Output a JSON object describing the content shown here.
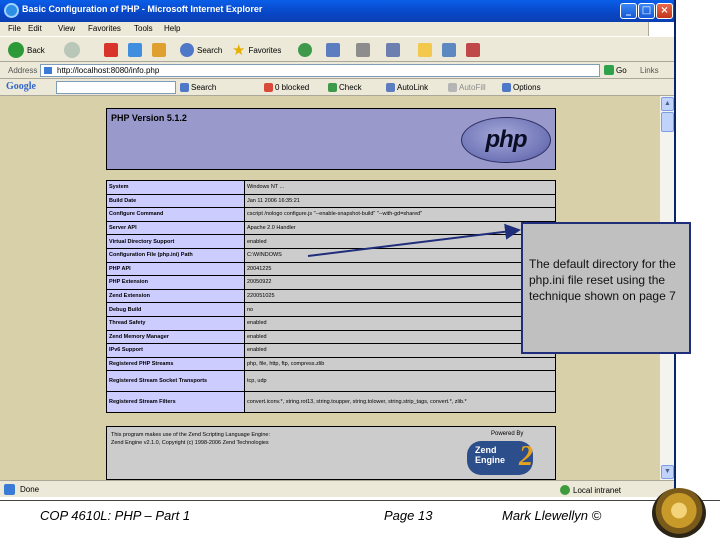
{
  "window": {
    "title": "Basic Configuration of PHP - Microsoft Internet Explorer",
    "min": "_",
    "max": "□",
    "close": "×"
  },
  "menu": [
    "File",
    "Edit",
    "View",
    "Favorites",
    "Tools",
    "Help"
  ],
  "toolbar": {
    "back": "Back",
    "search": "Search",
    "favorites": "Favorites"
  },
  "address": {
    "label": "Address",
    "url": "http://localhost:8080/info.php",
    "go": "Go",
    "links": "Links"
  },
  "google": {
    "logo": "Google",
    "search": "Search",
    "blocked": "0 blocked",
    "check": "Check",
    "autolink": "AutoLink",
    "autofill": "AutoFill",
    "options": "Options"
  },
  "php": {
    "version": "PHP Version 5.1.2",
    "logo": "php",
    "rows": [
      {
        "k": "System",
        "v": "Windows NT ...",
        "tall": false
      },
      {
        "k": "Build Date",
        "v": "Jan 11 2006 16:35:21",
        "tall": false
      },
      {
        "k": "Configure Command",
        "v": "cscript /nologo configure.js \"--enable-snapshot-build\" \"--with-gd=shared\"",
        "tall": false
      },
      {
        "k": "Server API",
        "v": "Apache 2.0 Handler",
        "tall": false
      },
      {
        "k": "Virtual Directory Support",
        "v": "enabled",
        "tall": false
      },
      {
        "k": "Configuration File (php.ini) Path",
        "v": "C:\\WINDOWS",
        "tall": false
      },
      {
        "k": "PHP API",
        "v": "20041225",
        "tall": false
      },
      {
        "k": "PHP Extension",
        "v": "20050922",
        "tall": false
      },
      {
        "k": "Zend Extension",
        "v": "220051025",
        "tall": false
      },
      {
        "k": "Debug Build",
        "v": "no",
        "tall": false
      },
      {
        "k": "Thread Safety",
        "v": "enabled",
        "tall": false
      },
      {
        "k": "Zend Memory Manager",
        "v": "enabled",
        "tall": false
      },
      {
        "k": "IPv6 Support",
        "v": "enabled",
        "tall": false
      },
      {
        "k": "Registered PHP Streams",
        "v": "php, file, http, ftp, compress.zlib",
        "tall": false
      },
      {
        "k": "Registered Stream Socket Transports",
        "v": "tcp, udp",
        "tall": true
      },
      {
        "k": "Registered Stream Filters",
        "v": "convert.iconv.*, string.rot13, string.toupper, string.tolower, string.strip_tags, convert.*, zlib.*",
        "tall": true
      }
    ],
    "footer_line1": "This program makes use of the Zend Scripting Language Engine:",
    "footer_line2": "Zend Engine v2.1.0, Copyright (c) 1998-2006 Zend Technologies",
    "powered_by": "Powered By",
    "zend_logo_line1": "Zend",
    "zend_logo_line2": "Engine",
    "zend_logo_num": "2"
  },
  "status": {
    "text": "Done",
    "zone": "Local intranet"
  },
  "callout": {
    "text": "The default directory for the php.ini file reset using the technique shown on page 7"
  },
  "slide": {
    "course": "COP 4610L: PHP – Part 1",
    "page": "Page 13",
    "author": "Mark Llewellyn ©"
  },
  "colors": {
    "arrow": "#1f2d7a",
    "page_bg": "#d8d0a8",
    "php_header": "#9999cc",
    "key_cell": "#ccccff",
    "value_cell": "#cccccc"
  }
}
